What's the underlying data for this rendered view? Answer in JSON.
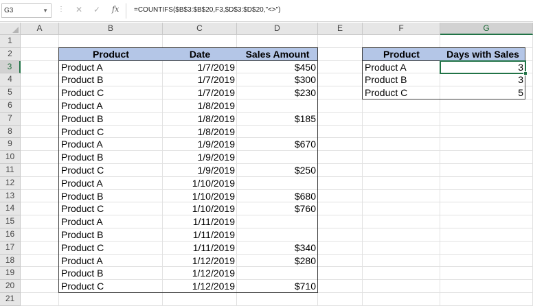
{
  "formula_bar": {
    "name_box": "G3",
    "formula": "=COUNTIFS($B$3:$B$20,F3,$D$3:$D$20,\"<>\")"
  },
  "columns": [
    "A",
    "B",
    "C",
    "D",
    "E",
    "F",
    "G"
  ],
  "rows": [
    "1",
    "2",
    "3",
    "4",
    "5",
    "6",
    "7",
    "8",
    "9",
    "10",
    "11",
    "12",
    "13",
    "14",
    "15",
    "16",
    "17",
    "18",
    "19",
    "20",
    "21"
  ],
  "sales_table": {
    "headers": {
      "product": "Product",
      "date": "Date",
      "amount": "Sales Amount"
    },
    "rows": [
      {
        "product": "Product A",
        "date": "1/7/2019",
        "amount": "$450"
      },
      {
        "product": "Product B",
        "date": "1/7/2019",
        "amount": "$300"
      },
      {
        "product": "Product C",
        "date": "1/7/2019",
        "amount": "$230"
      },
      {
        "product": "Product A",
        "date": "1/8/2019",
        "amount": ""
      },
      {
        "product": "Product B",
        "date": "1/8/2019",
        "amount": "$185"
      },
      {
        "product": "Product C",
        "date": "1/8/2019",
        "amount": ""
      },
      {
        "product": "Product A",
        "date": "1/9/2019",
        "amount": "$670"
      },
      {
        "product": "Product B",
        "date": "1/9/2019",
        "amount": ""
      },
      {
        "product": "Product C",
        "date": "1/9/2019",
        "amount": "$250"
      },
      {
        "product": "Product A",
        "date": "1/10/2019",
        "amount": ""
      },
      {
        "product": "Product B",
        "date": "1/10/2019",
        "amount": "$680"
      },
      {
        "product": "Product C",
        "date": "1/10/2019",
        "amount": "$760"
      },
      {
        "product": "Product A",
        "date": "1/11/2019",
        "amount": ""
      },
      {
        "product": "Product B",
        "date": "1/11/2019",
        "amount": ""
      },
      {
        "product": "Product C",
        "date": "1/11/2019",
        "amount": "$340"
      },
      {
        "product": "Product A",
        "date": "1/12/2019",
        "amount": "$280"
      },
      {
        "product": "Product B",
        "date": "1/12/2019",
        "amount": ""
      },
      {
        "product": "Product C",
        "date": "1/12/2019",
        "amount": "$710"
      }
    ]
  },
  "summary_table": {
    "headers": {
      "product": "Product",
      "days": "Days with Sales"
    },
    "rows": [
      {
        "product": "Product A",
        "days": "3"
      },
      {
        "product": "Product B",
        "days": "3"
      },
      {
        "product": "Product C",
        "days": "5"
      }
    ]
  },
  "colors": {
    "header_fill": "#b4c6e7",
    "selection": "#217346"
  },
  "icons": {
    "cancel": "close-icon",
    "enter": "check-icon",
    "function": "fx-icon"
  }
}
